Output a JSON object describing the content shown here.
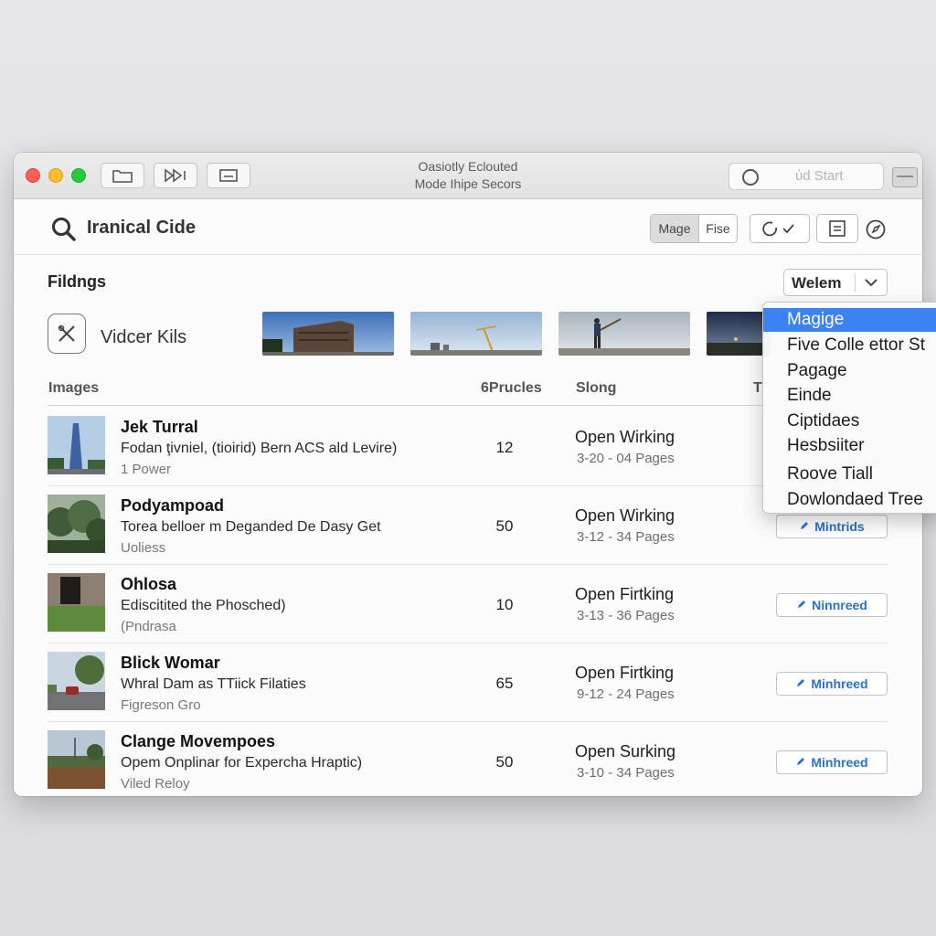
{
  "window": {
    "title_line1": "Oasiotly Eclouted",
    "title_line2": "Mode Ihipe Secors",
    "search_placeholder": "ὐd Start",
    "toolbar_icons": [
      "folder-icon",
      "media-icon",
      "tray-icon"
    ]
  },
  "header": {
    "app_title": "Iranical Cide",
    "segmented": {
      "active": "Mage",
      "inactive": "Fise"
    },
    "buttons": [
      "sync-check-icon",
      "document-icon",
      "compass-icon"
    ]
  },
  "section": {
    "label": "Fildngs",
    "dropdown_value": "Welem",
    "kit_label": "Vidcer Kils"
  },
  "columns": {
    "images": "Images",
    "count": "6Prucles",
    "status": "Slong",
    "extra": "T"
  },
  "rows": [
    {
      "title": "Jek Turral",
      "subtitle": "Fodan ţivniel, (tioirid) Bern ACS ald Levire)",
      "meta": "1 Power",
      "count": "12",
      "status": "Open Wirking",
      "pages": "3-20 - 04 Pages",
      "button": ""
    },
    {
      "title": "Podyampoad",
      "subtitle": "Torea belloer m Deganded De Dasy Get",
      "meta": "Uoliess",
      "count": "50",
      "status": "Open Wirking",
      "pages": "3-12 - 34 Pages",
      "button": "Mintrids"
    },
    {
      "title": "Ohlosa",
      "subtitle": "Ediscitited the Phosched)",
      "meta": "(Pndrasa",
      "count": "10",
      "status": "Open Firtking",
      "pages": "3-13 - 36 Pages",
      "button": "Ninnreed"
    },
    {
      "title": "Blick Womar",
      "subtitle": "Whral Dam as TTiick Filaties",
      "meta": "Figreson Gro",
      "count": "65",
      "status": "Open Firtking",
      "pages": "9-12 - 24 Pages",
      "button": "Minhreed"
    },
    {
      "title": "Clange Movempoes",
      "subtitle": "Opem Onplinar for Expercha Hraptic)",
      "meta": "Viled Reloy",
      "count": "50",
      "status": "Open Surking",
      "pages": "3-10 - 34 Pages",
      "button": "Minhreed"
    }
  ],
  "menu": {
    "items": [
      "Magige",
      "Five Colle ettor St",
      "Pagage",
      "Einde",
      "Ciptidaes",
      "Hesbsiiter",
      "Roove Tiall",
      "Dowlondaed Tree"
    ],
    "selected_index": 0
  },
  "colors": {
    "accent": "#3a83f1",
    "link": "#2a6fd6"
  }
}
